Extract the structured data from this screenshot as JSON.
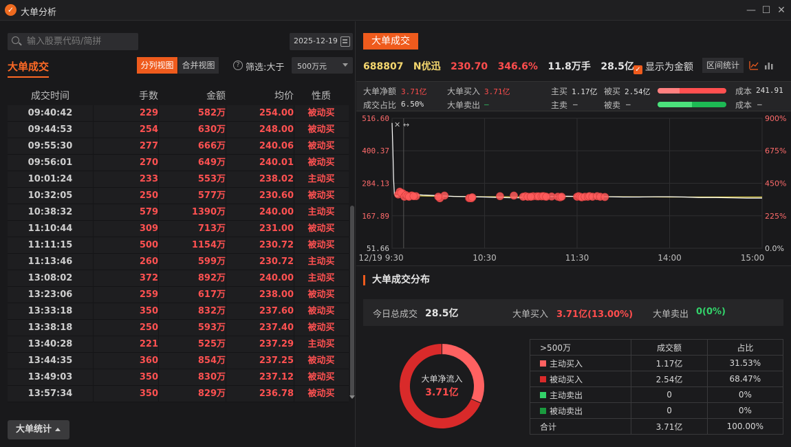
{
  "window": {
    "title": "大单分析",
    "logo": "app-logo-icon"
  },
  "left": {
    "search_placeholder": "输入股票代码/简拼",
    "date": "2025-12-19",
    "title": "大单成交",
    "view_split": "分列视图",
    "view_merge": "合并视图",
    "filter_label": "筛选:大于",
    "filter_value": "500万元",
    "columns": [
      "成交时间",
      "手数",
      "金额",
      "均价",
      "性质"
    ],
    "rows": [
      [
        "09:40:42",
        "229",
        "582万",
        "254.00",
        "被动买"
      ],
      [
        "09:44:53",
        "254",
        "630万",
        "248.00",
        "被动买"
      ],
      [
        "09:55:30",
        "277",
        "666万",
        "240.06",
        "被动买"
      ],
      [
        "09:56:01",
        "270",
        "649万",
        "240.01",
        "被动买"
      ],
      [
        "10:01:24",
        "233",
        "553万",
        "238.02",
        "主动买"
      ],
      [
        "10:32:05",
        "250",
        "577万",
        "230.60",
        "被动买"
      ],
      [
        "10:38:32",
        "579",
        "1390万",
        "240.00",
        "主动买"
      ],
      [
        "11:10:44",
        "309",
        "713万",
        "231.00",
        "被动买"
      ],
      [
        "11:11:15",
        "500",
        "1154万",
        "230.72",
        "被动买"
      ],
      [
        "11:13:46",
        "260",
        "599万",
        "230.72",
        "主动买"
      ],
      [
        "13:08:02",
        "372",
        "892万",
        "240.00",
        "主动买"
      ],
      [
        "13:23:06",
        "259",
        "617万",
        "238.00",
        "被动买"
      ],
      [
        "13:33:18",
        "350",
        "832万",
        "237.60",
        "被动买"
      ],
      [
        "13:38:18",
        "250",
        "593万",
        "237.40",
        "被动买"
      ],
      [
        "13:40:28",
        "221",
        "525万",
        "237.29",
        "主动买"
      ],
      [
        "13:44:35",
        "360",
        "854万",
        "237.25",
        "被动买"
      ],
      [
        "13:49:03",
        "350",
        "830万",
        "237.12",
        "被动买"
      ],
      [
        "13:57:34",
        "350",
        "829万",
        "236.78",
        "被动买"
      ]
    ],
    "stats_button": "大单统计"
  },
  "right": {
    "tab": "大单成交",
    "stock": {
      "code": "688807",
      "name": "N优迅",
      "price": "230.70",
      "change_pct": "346.6%",
      "volume": "11.8万手",
      "amount": "28.5亿"
    },
    "show_money_label": "显示为金额",
    "range_button": "区间统计",
    "info": {
      "net_label": "大单净额",
      "net_value": "3.71亿",
      "buy_label": "大单买入",
      "buy_value": "3.71亿",
      "ratio_label": "成交占比",
      "ratio_value": "6.50%",
      "sell_label": "大单卖出",
      "sell_value": "—",
      "active_buy_label": "主买",
      "active_buy_value": "1.17亿",
      "passive_buy_label": "被买",
      "passive_buy_value": "2.54亿",
      "active_sell_label": "主卖",
      "active_sell_value": "—",
      "passive_sell_label": "被卖",
      "passive_sell_value": "—",
      "cost_label": "成本",
      "cost_buy_value": "241.91",
      "cost_sell_label": "成本",
      "cost_sell_value": "—",
      "buy_bar_active_fraction": 0.32,
      "sell_bar_active_fraction": 0.5
    },
    "chart_data": {
      "type": "line",
      "y_left_ticks": [
        "516.60",
        "400.37",
        "284.13",
        "167.89",
        "51.66"
      ],
      "y_right_ticks": [
        "900%",
        "675%",
        "450%",
        "225%",
        "0.0%"
      ],
      "x_ticks": [
        "12/19 9:30",
        "10:30",
        "11:30",
        "14:00",
        "15:00"
      ],
      "ylim": [
        51.66,
        516.6
      ],
      "price": [
        [
          0,
          500
        ],
        [
          1,
          410
        ],
        [
          2,
          300
        ],
        [
          3,
          245
        ],
        [
          5,
          236
        ],
        [
          10,
          240
        ],
        [
          20,
          246
        ],
        [
          40,
          242
        ],
        [
          60,
          240
        ],
        [
          80,
          237
        ],
        [
          100,
          236
        ],
        [
          120,
          235
        ],
        [
          140,
          233
        ],
        [
          160,
          232
        ],
        [
          180,
          233
        ],
        [
          200,
          236
        ],
        [
          220,
          238
        ],
        [
          240,
          237
        ],
        [
          260,
          237
        ],
        [
          280,
          236
        ],
        [
          300,
          235
        ],
        [
          320,
          235
        ],
        [
          340,
          236
        ],
        [
          360,
          236
        ],
        [
          380,
          235
        ],
        [
          400,
          233
        ],
        [
          420,
          233
        ],
        [
          440,
          232
        ],
        [
          460,
          231
        ],
        [
          480,
          231
        ]
      ],
      "avg_price": [
        [
          3,
          240
        ],
        [
          60,
          238
        ],
        [
          120,
          236
        ],
        [
          180,
          236
        ],
        [
          240,
          237
        ],
        [
          300,
          236
        ],
        [
          360,
          235
        ],
        [
          420,
          235
        ],
        [
          480,
          235
        ]
      ],
      "big_orders": [
        [
          10,
          254.0
        ],
        [
          14,
          248.0
        ],
        [
          25,
          240.06
        ],
        [
          26,
          240.01
        ],
        [
          31,
          238.02
        ],
        [
          62,
          230.6
        ],
        [
          68,
          240.0
        ],
        [
          100,
          231.0
        ],
        [
          101,
          230.72
        ],
        [
          103,
          230.72
        ],
        [
          158,
          240.0
        ],
        [
          173,
          238.0
        ],
        [
          183,
          237.6
        ],
        [
          188,
          237.4
        ],
        [
          190,
          237.29
        ],
        [
          194,
          237.25
        ],
        [
          198,
          237.12
        ],
        [
          207,
          236.78
        ],
        [
          8,
          244
        ],
        [
          12,
          250
        ],
        [
          16,
          236
        ],
        [
          18,
          242
        ],
        [
          20,
          238
        ],
        [
          22,
          236
        ],
        [
          28,
          238
        ],
        [
          60,
          236
        ],
        [
          104,
          234
        ],
        [
          140,
          238
        ],
        [
          170,
          236
        ],
        [
          176,
          236
        ],
        [
          180,
          236
        ],
        [
          196,
          238
        ],
        [
          200,
          236
        ],
        [
          215,
          236
        ],
        [
          218,
          234
        ],
        [
          220,
          236
        ],
        [
          240,
          236
        ],
        [
          242,
          238
        ],
        [
          244,
          236
        ],
        [
          246,
          234
        ],
        [
          250,
          236
        ],
        [
          254,
          236
        ],
        [
          256,
          238
        ],
        [
          260,
          236
        ],
        [
          266,
          238
        ],
        [
          270,
          236
        ],
        [
          276,
          235
        ]
      ]
    },
    "distribution": {
      "title": "大单成交分布",
      "total_label": "今日总成交",
      "total_value": "28.5亿",
      "buy_label": "大单买入",
      "buy_value": "3.71亿(13.00%)",
      "sell_label": "大单卖出",
      "sell_value": "0(0%)",
      "donut_label": "大单净流入",
      "donut_value": "3.71亿",
      "donut_fractions": [
        0.3153,
        0.6847
      ],
      "table_headers": [
        ">500万",
        "成交额",
        "占比"
      ],
      "table_rows": [
        {
          "label": "主动买入",
          "amount": "1.17亿",
          "pct": "31.53%",
          "color": "#ff6161"
        },
        {
          "label": "被动买入",
          "amount": "2.54亿",
          "pct": "68.47%",
          "color": "#d92a2a"
        },
        {
          "label": "主动卖出",
          "amount": "0",
          "pct": "0%",
          "color": "#33d26a"
        },
        {
          "label": "被动卖出",
          "amount": "0",
          "pct": "0%",
          "color": "#1a9a3e"
        }
      ],
      "total_row": {
        "label": "合计",
        "amount": "3.71亿",
        "pct": "100.00%"
      }
    }
  },
  "colors": {
    "accent": "#ef5b1d",
    "red": "#ff4d4d",
    "green": "#33d26a"
  }
}
